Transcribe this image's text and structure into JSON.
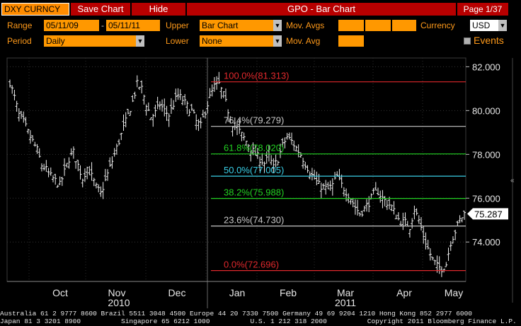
{
  "header": {
    "ticker": "DXY CURNCY",
    "save_chart": "Save Chart",
    "hide": "Hide",
    "title": "GPO - Bar Chart",
    "page": "Page 1/37"
  },
  "controls": {
    "range_label": "Range",
    "range_start": "05/11/09",
    "range_sep": "-",
    "range_end": "05/11/11",
    "upper_label": "Upper",
    "upper_value": "Bar Chart",
    "movavgs_label": "Mov. Avgs",
    "currency_label": "Currency",
    "currency_value": "USD",
    "period_label": "Period",
    "period_value": "Daily",
    "lower_label": "Lower",
    "lower_value": "None",
    "movavg_label": "Mov. Avg",
    "events_label": "Events"
  },
  "chart_data": {
    "type": "bar",
    "subtype": "ohlc",
    "ylim": [
      72.2,
      82.4
    ],
    "y_ticks": [
      "82.000",
      "80.000",
      "78.000",
      "76.000",
      "74.000"
    ],
    "y_tick_values": [
      82,
      80,
      78,
      76,
      74
    ],
    "month_labels": [
      "Oct",
      "Nov",
      "Dec",
      "Jan",
      "Feb",
      "Mar",
      "Apr",
      "May"
    ],
    "year_labels": [
      "2010",
      "2011"
    ],
    "last_price": "75.287",
    "last_value": 75.287,
    "fib_levels": [
      {
        "label": "100.0%(81.313)",
        "value": 81.313,
        "color": "#e0282c"
      },
      {
        "label": "76.4%(79.279)",
        "value": 79.279,
        "color": "#c8c8c8"
      },
      {
        "label": "61.8%(78.020)",
        "value": 78.02,
        "color": "#22d022"
      },
      {
        "label": "50.0%(77.005)",
        "value": 77.005,
        "color": "#3ad0e8"
      },
      {
        "label": "38.2%(75.988)",
        "value": 75.988,
        "color": "#22d022"
      },
      {
        "label": "23.6%(74.730)",
        "value": 74.73,
        "color": "#c8c8c8"
      },
      {
        "label": "0.0%(72.696)",
        "value": 72.696,
        "color": "#e0282c"
      }
    ],
    "close_path": [
      [
        0,
        81.3
      ],
      [
        4,
        80.6
      ],
      [
        8,
        79.8
      ],
      [
        12,
        79.5
      ],
      [
        16,
        79.0
      ],
      [
        20,
        78.6
      ],
      [
        24,
        78.2
      ],
      [
        28,
        77.5
      ],
      [
        32,
        77.3
      ],
      [
        36,
        77.0
      ],
      [
        40,
        76.8
      ],
      [
        44,
        76.6
      ],
      [
        48,
        77.2
      ],
      [
        52,
        77.8
      ],
      [
        56,
        78.1
      ],
      [
        60,
        77.5
      ],
      [
        64,
        76.9
      ],
      [
        68,
        77.4
      ],
      [
        72,
        77.0
      ],
      [
        76,
        76.5
      ],
      [
        80,
        76.2
      ],
      [
        84,
        76.8
      ],
      [
        88,
        77.4
      ],
      [
        92,
        78.0
      ],
      [
        96,
        78.6
      ],
      [
        100,
        79.2
      ],
      [
        104,
        79.8
      ],
      [
        108,
        80.4
      ],
      [
        112,
        81.2
      ],
      [
        116,
        81.0
      ],
      [
        120,
        80.3
      ],
      [
        124,
        79.7
      ],
      [
        128,
        79.9
      ],
      [
        132,
        80.3
      ],
      [
        136,
        80.0
      ],
      [
        140,
        79.8
      ],
      [
        144,
        80.3
      ],
      [
        148,
        80.7
      ],
      [
        152,
        80.5
      ],
      [
        156,
        80.2
      ],
      [
        160,
        80.0
      ],
      [
        164,
        79.5
      ],
      [
        168,
        79.3
      ],
      [
        172,
        80.0
      ],
      [
        176,
        80.6
      ],
      [
        180,
        81.1
      ],
      [
        184,
        81.2
      ],
      [
        188,
        80.7
      ],
      [
        192,
        80.0
      ],
      [
        196,
        79.4
      ],
      [
        200,
        79.2
      ],
      [
        204,
        78.9
      ],
      [
        208,
        78.6
      ],
      [
        212,
        78.3
      ],
      [
        216,
        78.0
      ],
      [
        220,
        77.8
      ],
      [
        224,
        77.6
      ],
      [
        228,
        77.9
      ],
      [
        232,
        77.4
      ],
      [
        236,
        77.8
      ],
      [
        240,
        78.4
      ],
      [
        244,
        78.8
      ],
      [
        248,
        78.6
      ],
      [
        252,
        78.3
      ],
      [
        256,
        78.0
      ],
      [
        260,
        77.6
      ],
      [
        264,
        77.2
      ],
      [
        268,
        76.9
      ],
      [
        272,
        76.6
      ],
      [
        276,
        76.5
      ],
      [
        280,
        76.4
      ],
      [
        284,
        76.6
      ],
      [
        288,
        77.0
      ],
      [
        292,
        76.6
      ],
      [
        296,
        76.3
      ],
      [
        300,
        76.0
      ],
      [
        304,
        75.6
      ],
      [
        308,
        75.3
      ],
      [
        312,
        75.5
      ],
      [
        316,
        75.8
      ],
      [
        320,
        76.2
      ],
      [
        324,
        76.3
      ],
      [
        328,
        76.0
      ],
      [
        332,
        75.8
      ],
      [
        336,
        75.6
      ],
      [
        340,
        75.2
      ],
      [
        344,
        74.9
      ],
      [
        348,
        74.9
      ],
      [
        352,
        74.7
      ],
      [
        356,
        75.5
      ],
      [
        360,
        75.0
      ],
      [
        364,
        74.3
      ],
      [
        368,
        73.7
      ],
      [
        372,
        73.2
      ],
      [
        376,
        72.9
      ],
      [
        380,
        72.8
      ],
      [
        384,
        73.0
      ],
      [
        388,
        74.0
      ],
      [
        392,
        74.5
      ],
      [
        396,
        75.0
      ],
      [
        400,
        75.3
      ]
    ]
  },
  "footer": {
    "line1": "Australia 61 2 9777 8600 Brazil 5511 3048 4500 Europe 44 20 7330 7500 Germany 49 69 9204 1210 Hong Kong 852 2977 6000",
    "line2": "Japan 81 3 3201 8900          Singapore 65 6212 1000          U.S. 1 212 318 2000          Copyright 2011 Bloomberg Finance L.P."
  },
  "colors": {
    "background": "#000000",
    "accent_orange": "#ff9800",
    "header_red": "#b80000",
    "label_orange": "#ff9a1a"
  }
}
